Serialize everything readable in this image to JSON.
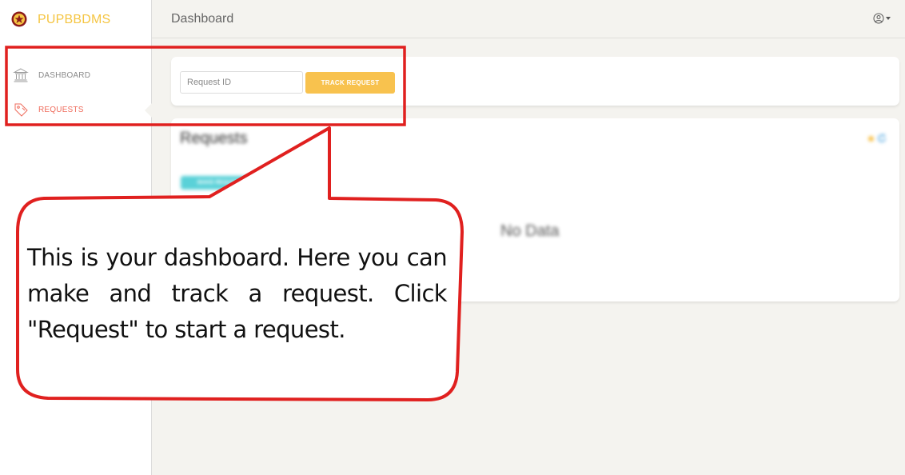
{
  "app": {
    "brand_name": "PUPBBDMS"
  },
  "sidebar": {
    "items": [
      {
        "label": "DASHBOARD",
        "icon": "bank-icon"
      },
      {
        "label": "REQUESTS",
        "icon": "tag-icon"
      }
    ]
  },
  "header": {
    "title": "Dashboard",
    "user_icon": "user-circle-icon"
  },
  "track": {
    "placeholder": "Request ID",
    "button_label": "TRACK REQUEST"
  },
  "requests": {
    "title": "Requests",
    "make_button_label": "MAKE REQUEST",
    "empty_text": "No Data"
  },
  "tutorial": {
    "text": "This is your dashboard. Here you can make and track a request. Click \"Request\" to start a request."
  },
  "colors": {
    "brand": "#f5c542",
    "accent_button": "#f8c24e",
    "active_nav": "#ef6b5b",
    "callout_border": "#e0201f",
    "make_button": "#5ad1d8"
  }
}
